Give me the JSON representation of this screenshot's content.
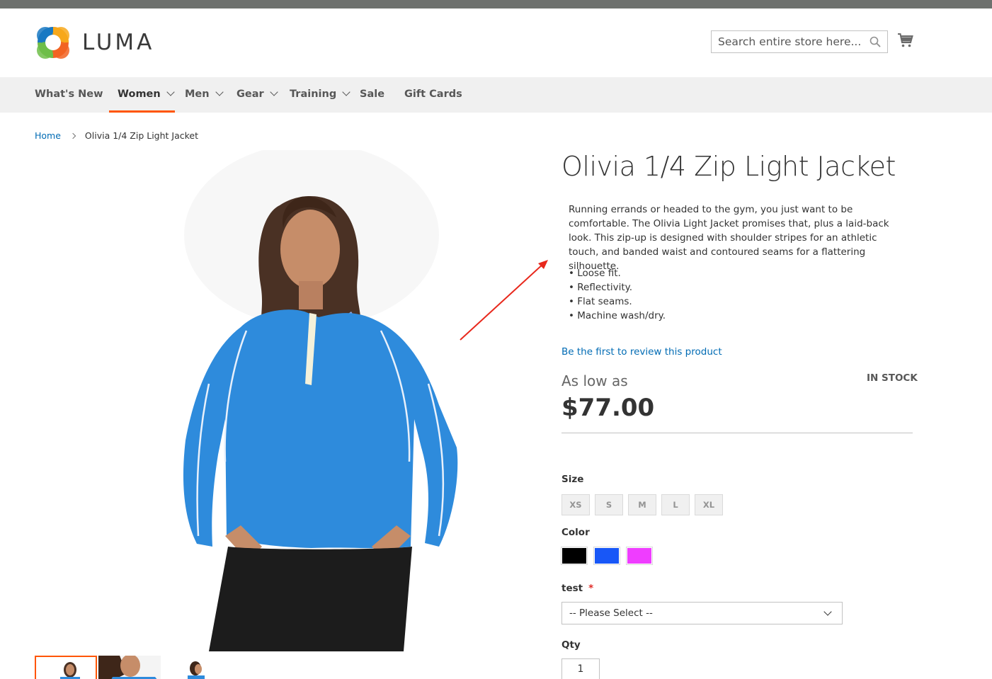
{
  "store": {
    "logo_text": "LUMA"
  },
  "search": {
    "placeholder": "Search entire store here..."
  },
  "nav": {
    "items": [
      {
        "label": "What's New"
      },
      {
        "label": "Women"
      },
      {
        "label": "Men"
      },
      {
        "label": "Gear"
      },
      {
        "label": "Training"
      },
      {
        "label": "Sale"
      },
      {
        "label": "Gift Cards"
      }
    ]
  },
  "breadcrumb": {
    "home": "Home",
    "current": "Olivia 1/4 Zip Light Jacket"
  },
  "product": {
    "title": "Olivia 1/4 Zip Light Jacket",
    "description": "Running errands or headed to the gym, you just want to be comfortable. The Olivia Light Jacket promises that, plus a laid-back look. This zip-up is designed with shoulder stripes for an athletic touch, and banded waist and contoured seams for a flattering silhouette.",
    "bullets": [
      "• Loose fit.",
      "• Reflectivity.",
      "• Flat seams.",
      "• Machine wash/dry."
    ],
    "review_link": "Be the first to review this product",
    "price_prefix": "As low as",
    "price": "$77.00",
    "stock": "IN STOCK"
  },
  "options": {
    "size_label": "Size",
    "sizes": [
      "XS",
      "S",
      "M",
      "L",
      "XL"
    ],
    "color_label": "Color",
    "colors": [
      "#000000",
      "#1857f7",
      "#ef3dff"
    ],
    "test_label": "test",
    "required_mark": "*",
    "test_select_value": "-- Please Select --",
    "qty_label": "Qty",
    "qty_value": "1"
  },
  "colors": {
    "accent": "#ff5501",
    "link": "#006bb4",
    "nav_bg": "#f0f0f0",
    "annotation_arrow": "#e8281c"
  }
}
